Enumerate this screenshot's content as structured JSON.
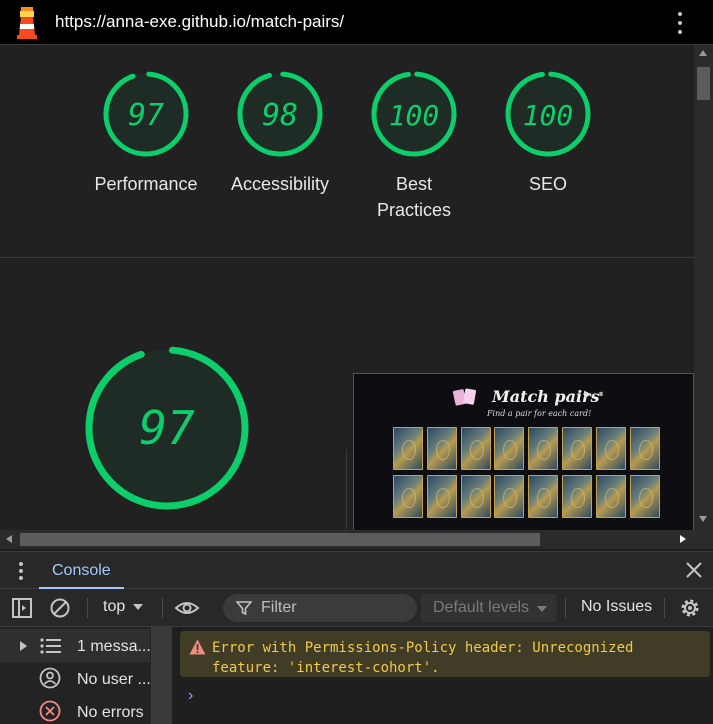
{
  "browser": {
    "url": "https://anna-exe.github.io/match-pairs/",
    "menu_icon": "kebab-menu-icon",
    "site_icon": "lighthouse-icon"
  },
  "report": {
    "categories": [
      {
        "label": "Performance",
        "score": 97
      },
      {
        "label": "Accessibility",
        "score": 98
      },
      {
        "label": "Best Practices",
        "score": 100
      },
      {
        "label": "SEO",
        "score": 100
      }
    ],
    "main_score": 97,
    "score_color": "#0cce6b",
    "screenshot": {
      "title": "Match pairs",
      "subtitle": "Find a pair for each card!",
      "controls": "▶ ⏸"
    }
  },
  "drawer": {
    "tab": "Console",
    "close_icon": "close-icon"
  },
  "toolbar": {
    "context": "top",
    "filter_placeholder": "Filter",
    "levels": "Default levels",
    "issues": "No Issues"
  },
  "sidebar": {
    "items": [
      {
        "label": "1 messa...",
        "icon": "list-icon"
      },
      {
        "label": "No user ...",
        "icon": "user-icon"
      },
      {
        "label": "No errors",
        "icon": "error-icon"
      }
    ]
  },
  "console": {
    "warning_line1": "Error with Permissions-Policy header: Unrecognized",
    "warning_line2": "feature: 'interest-cohort'.",
    "prompt": "›",
    "warning_color": "#f2c94c"
  }
}
